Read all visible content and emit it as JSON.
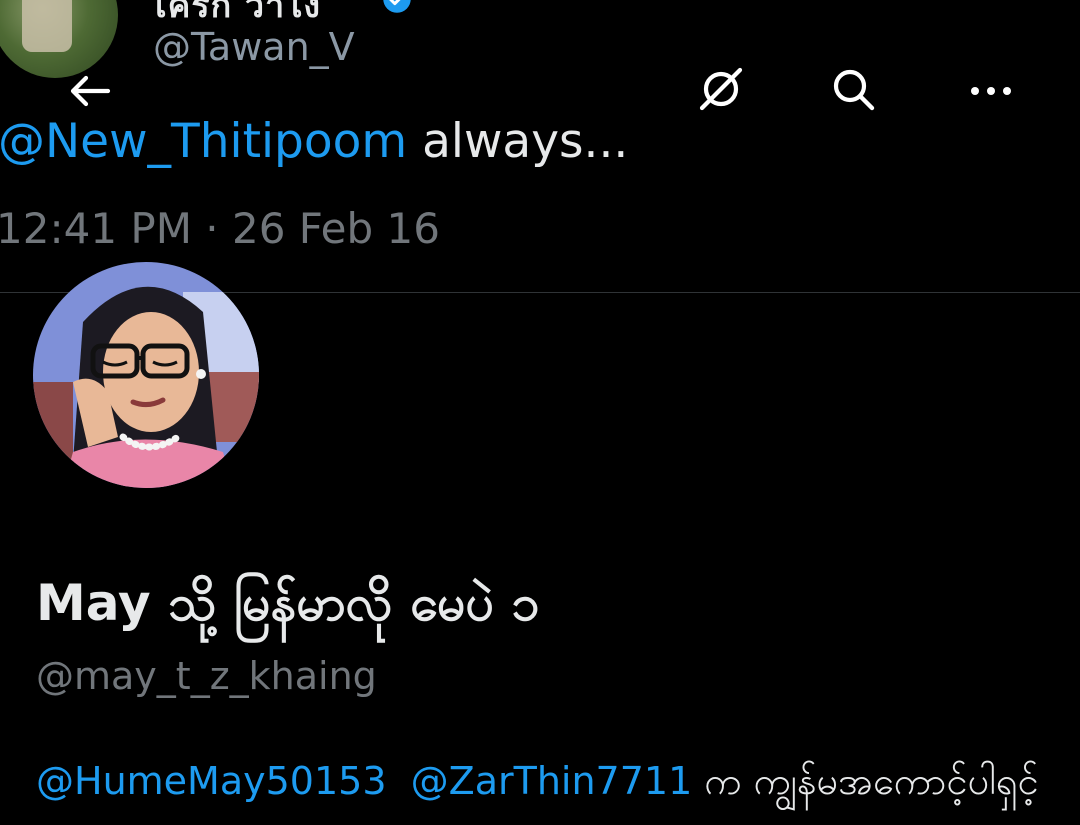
{
  "previous_tweet": {
    "author_name": "เคิร์ก ว่าไง",
    "author_handle": "@Tawan_V",
    "mention": "@New_Thitipoom",
    "text": " always...",
    "timestamp": "12:41 PM · 26 Feb 16"
  },
  "topbar": {
    "back_icon": "arrow-left-icon",
    "mute_icon": "no-grok-icon",
    "search_icon": "search-icon",
    "more_icon": "more-horizontal-icon"
  },
  "reply_author": {
    "name": "May သို့ မြန်မာလို မေပဲ ၁",
    "handle": "@may_t_z_khaing"
  },
  "reply_body": {
    "mention_1": "@HumeMay50153",
    "mention_2": "@ZarThin7711",
    "text": " က ကျွန်မအကောင့်ပါရှင့်"
  },
  "colors": {
    "background": "#000000",
    "mention": "#1d9bf0",
    "secondary_text": "#71767b"
  }
}
